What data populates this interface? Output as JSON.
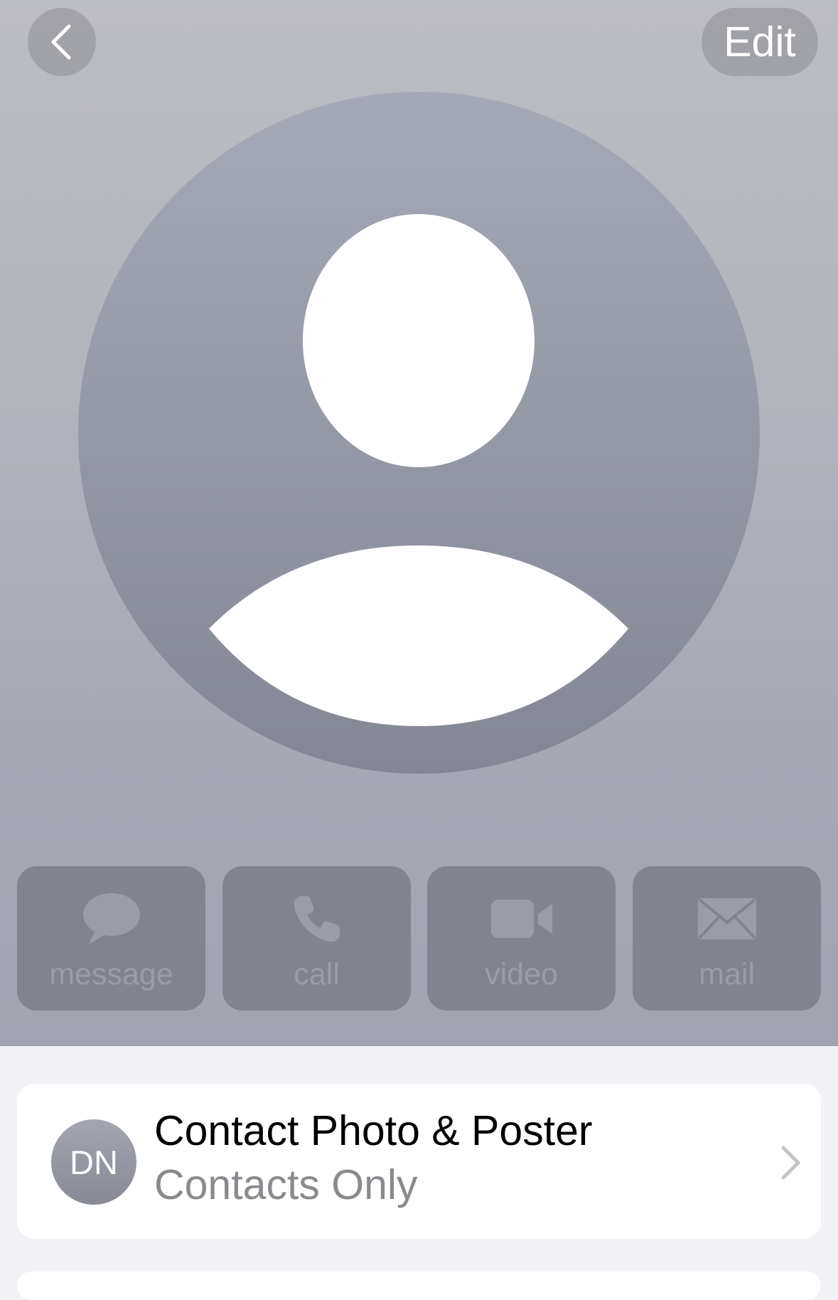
{
  "header": {
    "back_icon": "chevron-left-icon",
    "edit_label": "Edit",
    "avatar_icon": "person-silhouette-icon"
  },
  "actions": [
    {
      "label": "message",
      "icon": "message-bubble-icon"
    },
    {
      "label": "call",
      "icon": "phone-icon"
    },
    {
      "label": "video",
      "icon": "video-camera-icon"
    },
    {
      "label": "mail",
      "icon": "envelope-icon"
    }
  ],
  "contact_card": {
    "initials": "DN",
    "title": "Contact Photo & Poster",
    "subtitle": "Contacts Only",
    "chevron_icon": "chevron-right-icon"
  },
  "colors": {
    "header_top": "#bcbdc2",
    "header_bottom": "#a1a3b0",
    "avatar_circle": "#8e909c",
    "action_button": "#81838f",
    "action_label": "#9a9ca7",
    "page_background": "#f2f2f6",
    "subtitle_text": "#8a8a8e"
  }
}
